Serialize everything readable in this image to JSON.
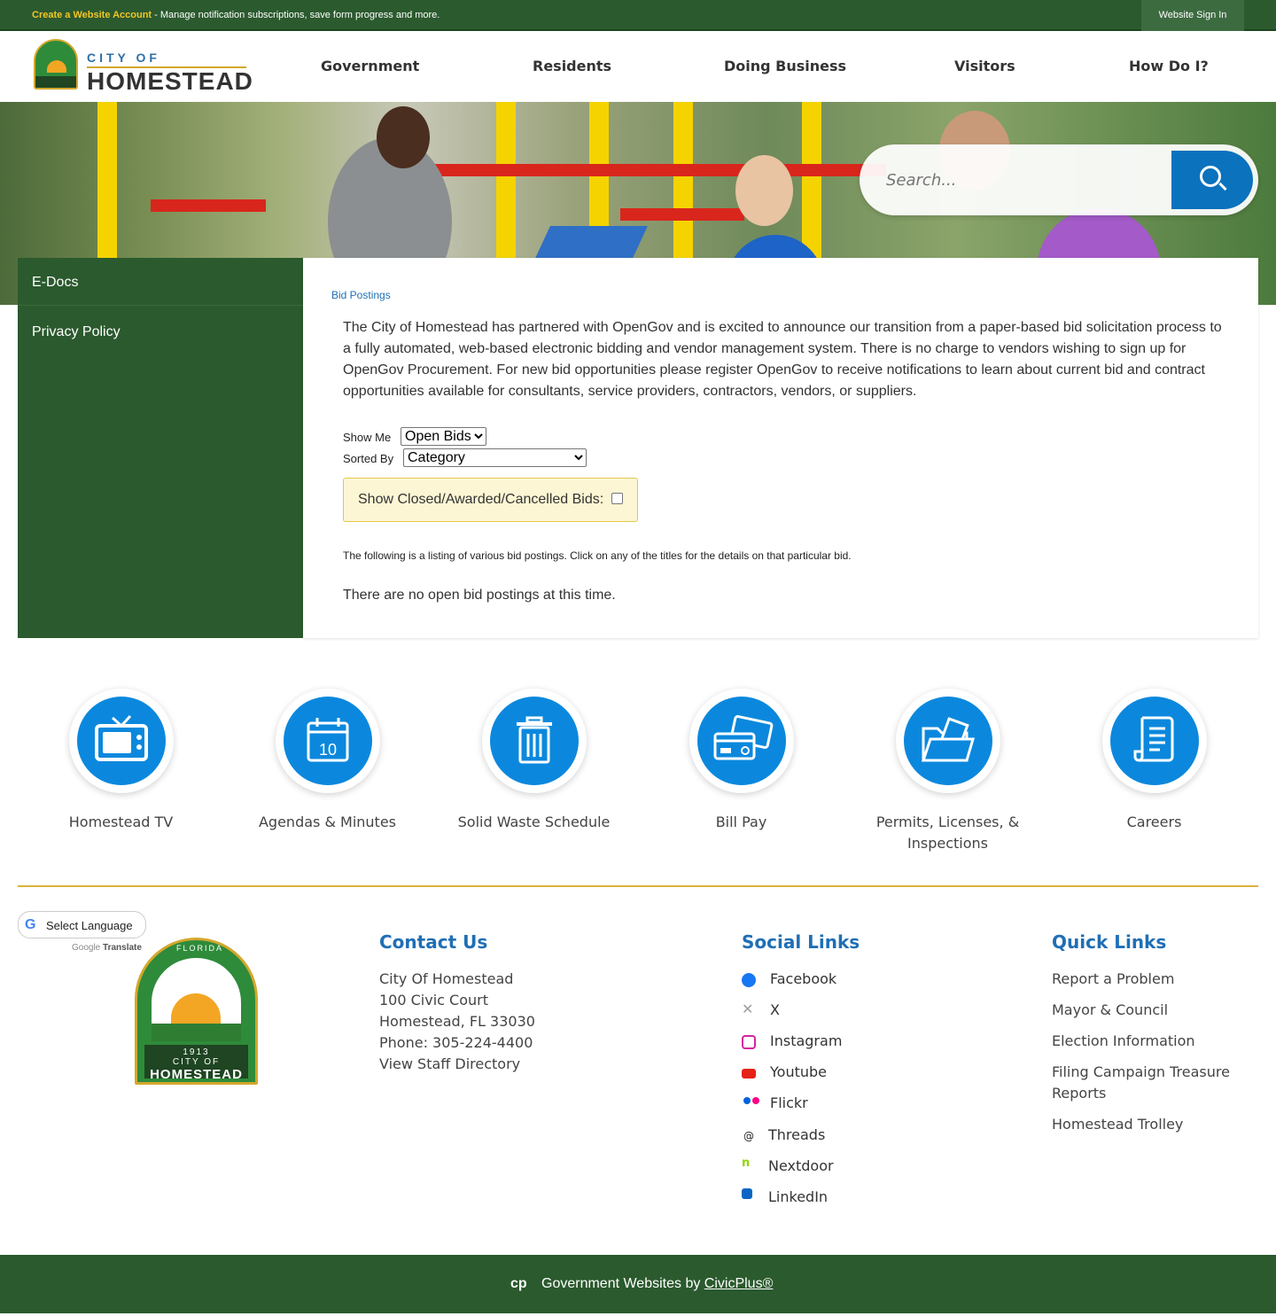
{
  "topbar": {
    "create_link": "Create a Website Account",
    "message": " - Manage notification subscriptions, save form progress and more.",
    "signin_label": "Website Sign In"
  },
  "logo": {
    "city_of": "CITY OF",
    "name": "HOMESTEAD"
  },
  "nav": {
    "items": [
      "Government",
      "Residents",
      "Doing Business",
      "Visitors",
      "How Do I?"
    ]
  },
  "search": {
    "placeholder": "Search..."
  },
  "sidebar": {
    "items": [
      "E-Docs",
      "Privacy Policy"
    ]
  },
  "main": {
    "breadcrumb": "Bid Postings",
    "intro": "The City of Homestead has partnered with OpenGov and is excited to announce our transition from a paper-based bid solicitation process to a fully automated, web-based electronic bidding and vendor management system. There is no charge to vendors wishing to sign up for OpenGov Procurement. For new bid opportunities please register OpenGov to receive notifications to learn about current bid and contract opportunities available for consultants, service providers, contractors, vendors, or suppliers.",
    "show_me_label": "Show Me",
    "show_me_value": "Open Bids",
    "sorted_by_label": "Sorted By",
    "sorted_by_value": "Category",
    "closed_label": "Show Closed/Awarded/Cancelled Bids:",
    "listing_note": "The following is a listing of various bid postings. Click on any of the titles for the details on that particular bid.",
    "no_bids": "There are no open bid postings at this time."
  },
  "quick_icons": [
    {
      "label": "Homestead TV",
      "icon": "tv-icon"
    },
    {
      "label": "Agendas & Minutes",
      "icon": "calendar-icon",
      "day": "10"
    },
    {
      "label": "Solid Waste Schedule",
      "icon": "trash-icon"
    },
    {
      "label": "Bill Pay",
      "icon": "credit-card-icon"
    },
    {
      "label": "Permits, Licenses, & Inspections",
      "icon": "folder-icon"
    },
    {
      "label": "Careers",
      "icon": "document-icon"
    }
  ],
  "footer": {
    "translate_label": "Select Language",
    "powered_by": "Google",
    "powered_translate": "Translate",
    "seal": {
      "arc": "FLORIDA",
      "year": "1913",
      "city_of": "CITY OF",
      "name": "HOMESTEAD"
    },
    "contact": {
      "heading": "Contact Us",
      "lines": [
        "City Of Homestead",
        "100 Civic Court",
        "Homestead, FL 33030",
        "Phone: 305-224-4400",
        "View Staff Directory"
      ]
    },
    "social": {
      "heading": "Social Links",
      "items": [
        {
          "label": "Facebook",
          "icon": "facebook-icon",
          "color": "#1877f2"
        },
        {
          "label": "X",
          "icon": "x-icon",
          "color": "#9e9e9e"
        },
        {
          "label": "Instagram",
          "icon": "instagram-icon",
          "color": "#d6249f"
        },
        {
          "label": "Youtube",
          "icon": "youtube-icon",
          "color": "#e62117"
        },
        {
          "label": "Flickr",
          "icon": "flickr-icon",
          "color": "#0063dc"
        },
        {
          "label": "Threads",
          "icon": "threads-icon",
          "color": "#222222"
        },
        {
          "label": "Nextdoor",
          "icon": "nextdoor-icon",
          "color": "#8ed500"
        },
        {
          "label": "LinkedIn",
          "icon": "linkedin-icon",
          "color": "#0a66c2"
        }
      ]
    },
    "quick_links": {
      "heading": "Quick Links",
      "items": [
        "Report a Problem",
        "Mayor & Council",
        "Election Information",
        "Filing Campaign Treasure Reports",
        "Homestead Trolley"
      ]
    }
  },
  "bottombar": {
    "text": "Government Websites by ",
    "link": "CivicPlus®"
  },
  "colors": {
    "green": "#2b5a2e",
    "blue": "#0b88dd",
    "gold": "#d9b23a",
    "link": "#1f6fb5"
  }
}
